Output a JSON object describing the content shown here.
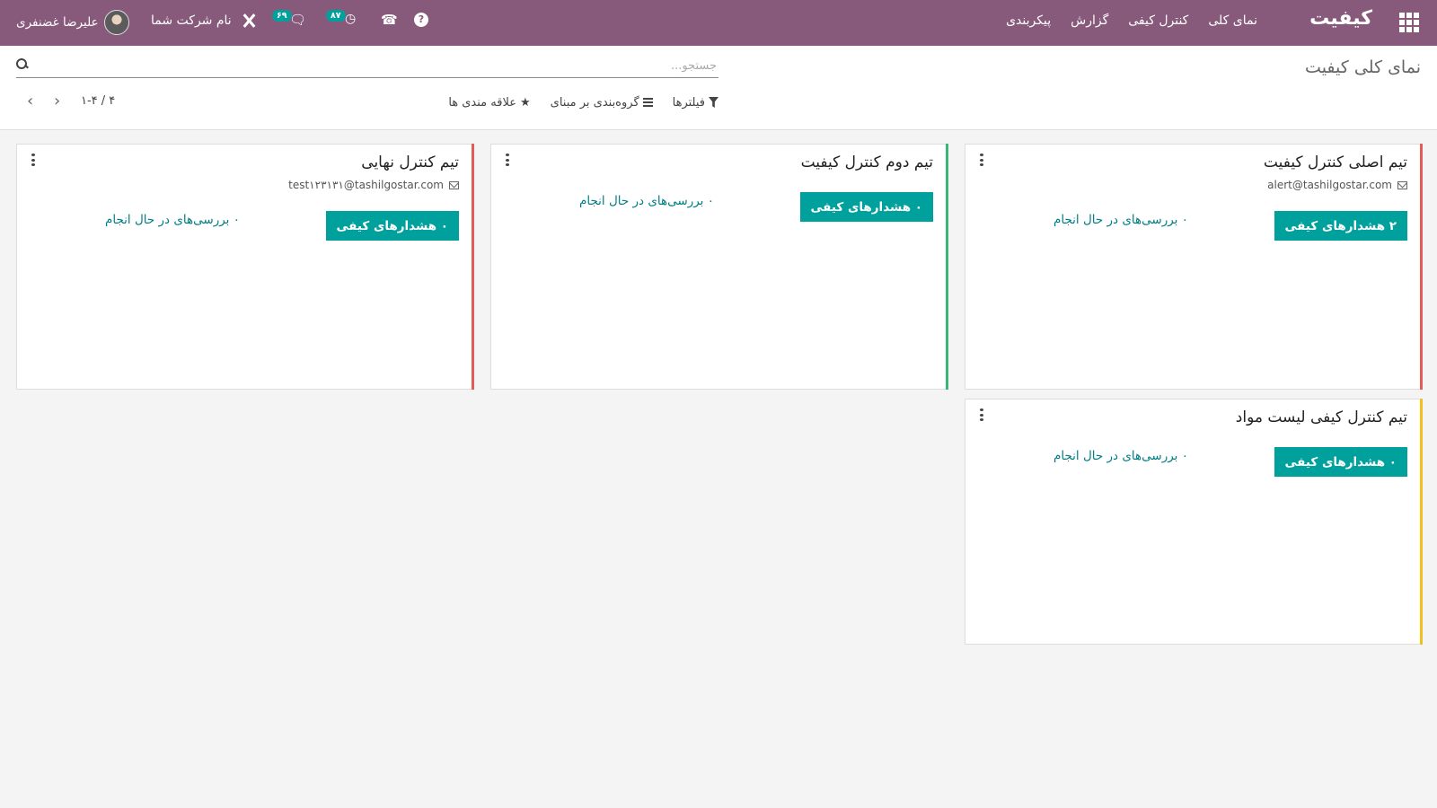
{
  "navbar": {
    "brand": "کیفیت",
    "menu": [
      "نمای کلی",
      "کنترل کیفی",
      "گزارش",
      "پیکربندی"
    ],
    "user_name": "علیرضا غضنفری",
    "company": "نام شرکت شما",
    "messages_count": "۶۹",
    "activities_count": "۸۷",
    "help": "?",
    "icons": [
      "apps-grid-icon",
      "tools-icon",
      "chat-icon",
      "clock-icon",
      "phone-icon",
      "help-icon"
    ]
  },
  "control_panel": {
    "page_title": "نمای کلی کیفیت",
    "search_placeholder": "جستجو...",
    "filters_label": "فیلترها",
    "groupby_label": "گروه‌بندی بر مبنای",
    "favorites_label": "علاقه مندی ها",
    "pager_text": "۱-۴ / ۴"
  },
  "cards": [
    {
      "title": "تیم اصلی کنترل کیفیت",
      "email": "alert@tashilgostar.com",
      "alerts_label": "۲ هشدارهای کیفی",
      "in_progress_label": "۰ بررسی‌های در حال انجام",
      "stripe_color": "#e45b5b"
    },
    {
      "title": "تیم دوم کنترل کیفیت",
      "email": "",
      "alerts_label": "۰ هشدارهای کیفی",
      "in_progress_label": "۰ بررسی‌های در حال انجام",
      "stripe_color": "#3bb57a"
    },
    {
      "title": "تیم کنترل نهایی",
      "email": "test۱۲۳۱۳۱@tashilgostar.com",
      "alerts_label": "۰ هشدارهای کیفی",
      "in_progress_label": "۰ بررسی‌های در حال انجام",
      "stripe_color": "#e45b5b"
    },
    {
      "title": "تیم کنترل کیفی لیست مواد",
      "email": "",
      "alerts_label": "۰ هشدارهای کیفی",
      "in_progress_label": "۰ بررسی‌های در حال انجام",
      "stripe_color": "#f2c01e"
    }
  ],
  "colors": {
    "navbar": "#875a7b",
    "primary_button": "#00a09d",
    "link": "#017e84"
  }
}
